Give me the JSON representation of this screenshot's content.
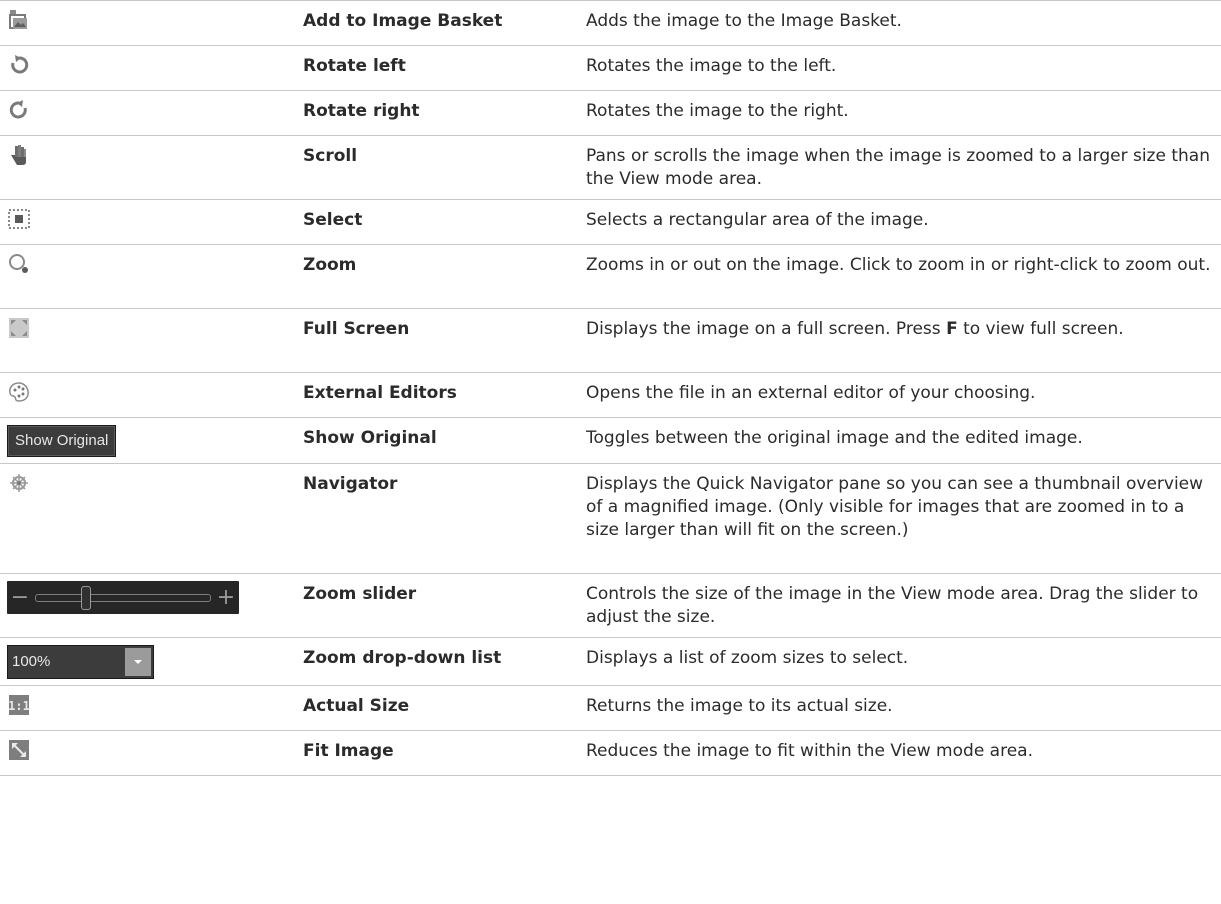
{
  "rows": [
    {
      "name": "Add to Image Basket",
      "desc": "Adds the image to the Image Basket."
    },
    {
      "name": "Rotate left",
      "desc": "Rotates the image to the left."
    },
    {
      "name": "Rotate right",
      "desc": "Rotates the image to the right."
    },
    {
      "name": "Scroll",
      "desc": "Pans or scrolls the image when the image is zoomed to a larger size than the View mode area."
    },
    {
      "name": "Select",
      "desc": "Selects a rectangular area of the image."
    },
    {
      "name": "Zoom",
      "desc": "Zooms in or out on the image. Click to zoom in or right-click to zoom out."
    },
    {
      "name": "Full Screen",
      "desc_before": "Displays the image on a full screen. Press ",
      "desc_key": "F",
      "desc_after": " to view full screen."
    },
    {
      "name": "External Editors",
      "desc": "Opens the file in an external editor of your choosing."
    },
    {
      "name": "Show Original",
      "desc": "Toggles between the original image and the edited image.",
      "button_label": "Show Original"
    },
    {
      "name": "Navigator",
      "desc": "Displays the Quick Navigator pane so you can see a thumbnail overview of a magnified image. (Only visible for images that are zoomed in to a size larger than will fit on the screen.)"
    },
    {
      "name": "Zoom slider",
      "desc": "Controls the size of the image in the View mode area. Drag the slider to adjust the size.",
      "slider_position": 0.28
    },
    {
      "name": "Zoom drop-down list",
      "desc": "Displays a list of zoom sizes to select.",
      "dropdown_value": "100%"
    },
    {
      "name": "Actual Size",
      "desc": "Returns the image to its actual size."
    },
    {
      "name": "Fit Image",
      "desc": "Reduces the image to fit within the View mode area."
    }
  ],
  "icons": [
    "image-basket-icon",
    "rotate-left-icon",
    "rotate-right-icon",
    "hand-icon",
    "select-icon",
    "zoom-icon",
    "full-screen-icon",
    "palette-icon",
    "show-original-button",
    "navigator-icon",
    "zoom-slider",
    "zoom-dropdown",
    "actual-size-icon",
    "fit-image-icon"
  ]
}
